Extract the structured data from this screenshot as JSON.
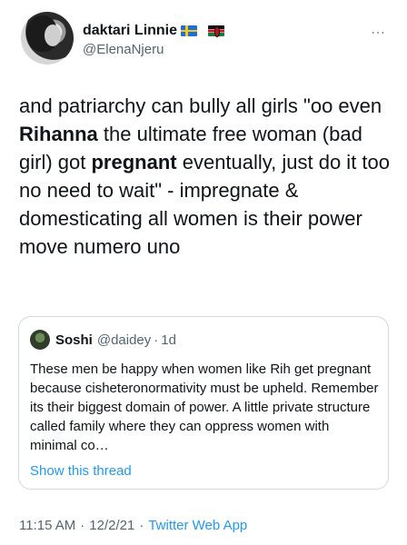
{
  "author": {
    "name": "daktari Linnie",
    "handle": "@ElenaNjeru",
    "flags": [
      "sweden-flag",
      "kenya-flag"
    ]
  },
  "more_icon": "⋯",
  "tweet": {
    "part1": "and patriarchy can bully all girls \"oo even ",
    "bold1": "Rihanna",
    "part2": " the ultimate free woman (bad girl) got ",
    "bold2": "pregnant",
    "part3": " eventually, just do it too no need to wait\" - impregnate & domesticating all women is their power move numero uno"
  },
  "quote": {
    "name": "Soshi",
    "handle": "@daidey",
    "separator": "·",
    "time": "1d",
    "text": "These men be happy when women like Rih get pregnant because cisheteronormativity must be upheld. Remember its their biggest domain of power. A little private structure called family where they can oppress women with minimal co…",
    "show_thread": "Show this thread"
  },
  "meta": {
    "time": "11:15 AM",
    "separator": "·",
    "date": "12/2/21",
    "app": "Twitter Web App"
  },
  "colors": {
    "link": "#1d9bf0",
    "secondary": "#536471",
    "border": "#cfd9de"
  }
}
